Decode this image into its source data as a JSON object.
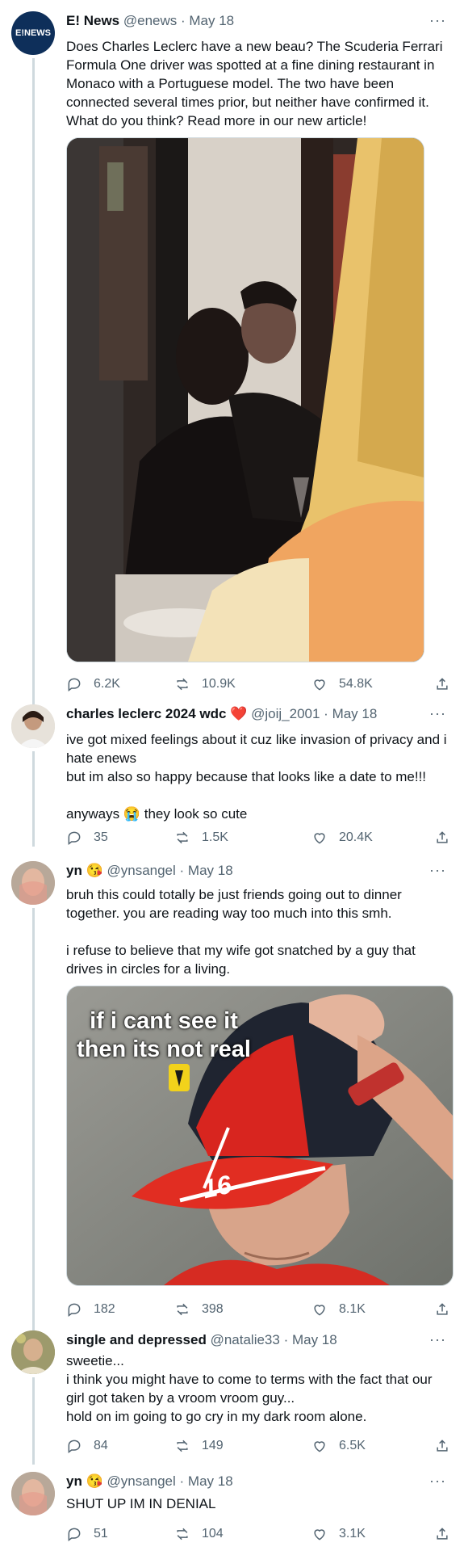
{
  "tweets": [
    {
      "name": "E! News",
      "handle": "@enews",
      "date": "May 18",
      "avatar_text": "E!NEWS",
      "text": "Does Charles Leclerc have a new beau? The Scuderia Ferrari Formula One driver was spotted at a fine dining restaurant in Monaco with a Portuguese model. The two have been connected several times prior, but neither have confirmed it. What do you think? Read more in our new article!",
      "replies": "6.2K",
      "retweets": "10.9K",
      "likes": "54.8K"
    },
    {
      "name": "charles leclerc 2024 wdc",
      "name_emoji": "❤️",
      "handle": "@joij_2001",
      "date": "May 18",
      "text": "ive got mixed feelings about it cuz like invasion of privacy and i hate enews\nbut im also so happy because that looks like a date to me!!!\n\nanyways 😭 they look so cute",
      "replies": "35",
      "retweets": "1.5K",
      "likes": "20.4K"
    },
    {
      "name": "yn",
      "name_emoji": "😘",
      "handle": "@ynsangel",
      "date": "May 18",
      "text": "bruh this could totally be just friends going out to dinner together. you are reading way too much into this smh.\n\ni refuse to believe that my wife got snatched by a guy that drives in circles for a living.",
      "meme_caption_line1": "if i cant see it",
      "meme_caption_line2": "then its not real",
      "cap_number": "16",
      "replies": "182",
      "retweets": "398",
      "likes": "8.1K"
    },
    {
      "name": "single and depressed",
      "handle": "@natalie33",
      "date": "May 18",
      "text": "sweetie...\ni think you might have to come to terms with the fact that our girl got taken by a vroom vroom guy...\nhold on im going to go cry in my dark room alone.",
      "replies": "84",
      "retweets": "149",
      "likes": "6.5K"
    },
    {
      "name": "yn",
      "name_emoji": "😘",
      "handle": "@ynsangel",
      "date": "May 18",
      "text": "SHUT UP IM IN DENIAL",
      "replies": "51",
      "retweets": "104",
      "likes": "3.1K"
    }
  ],
  "separator": " · ",
  "more_glyph": "···",
  "colors": {
    "text": "#0f1419",
    "secondary": "#536471",
    "thread_line": "#cfd9de",
    "heart": "#e0245e"
  },
  "icons": [
    "reply-icon",
    "retweet-icon",
    "like-icon",
    "share-icon",
    "more-icon"
  ]
}
